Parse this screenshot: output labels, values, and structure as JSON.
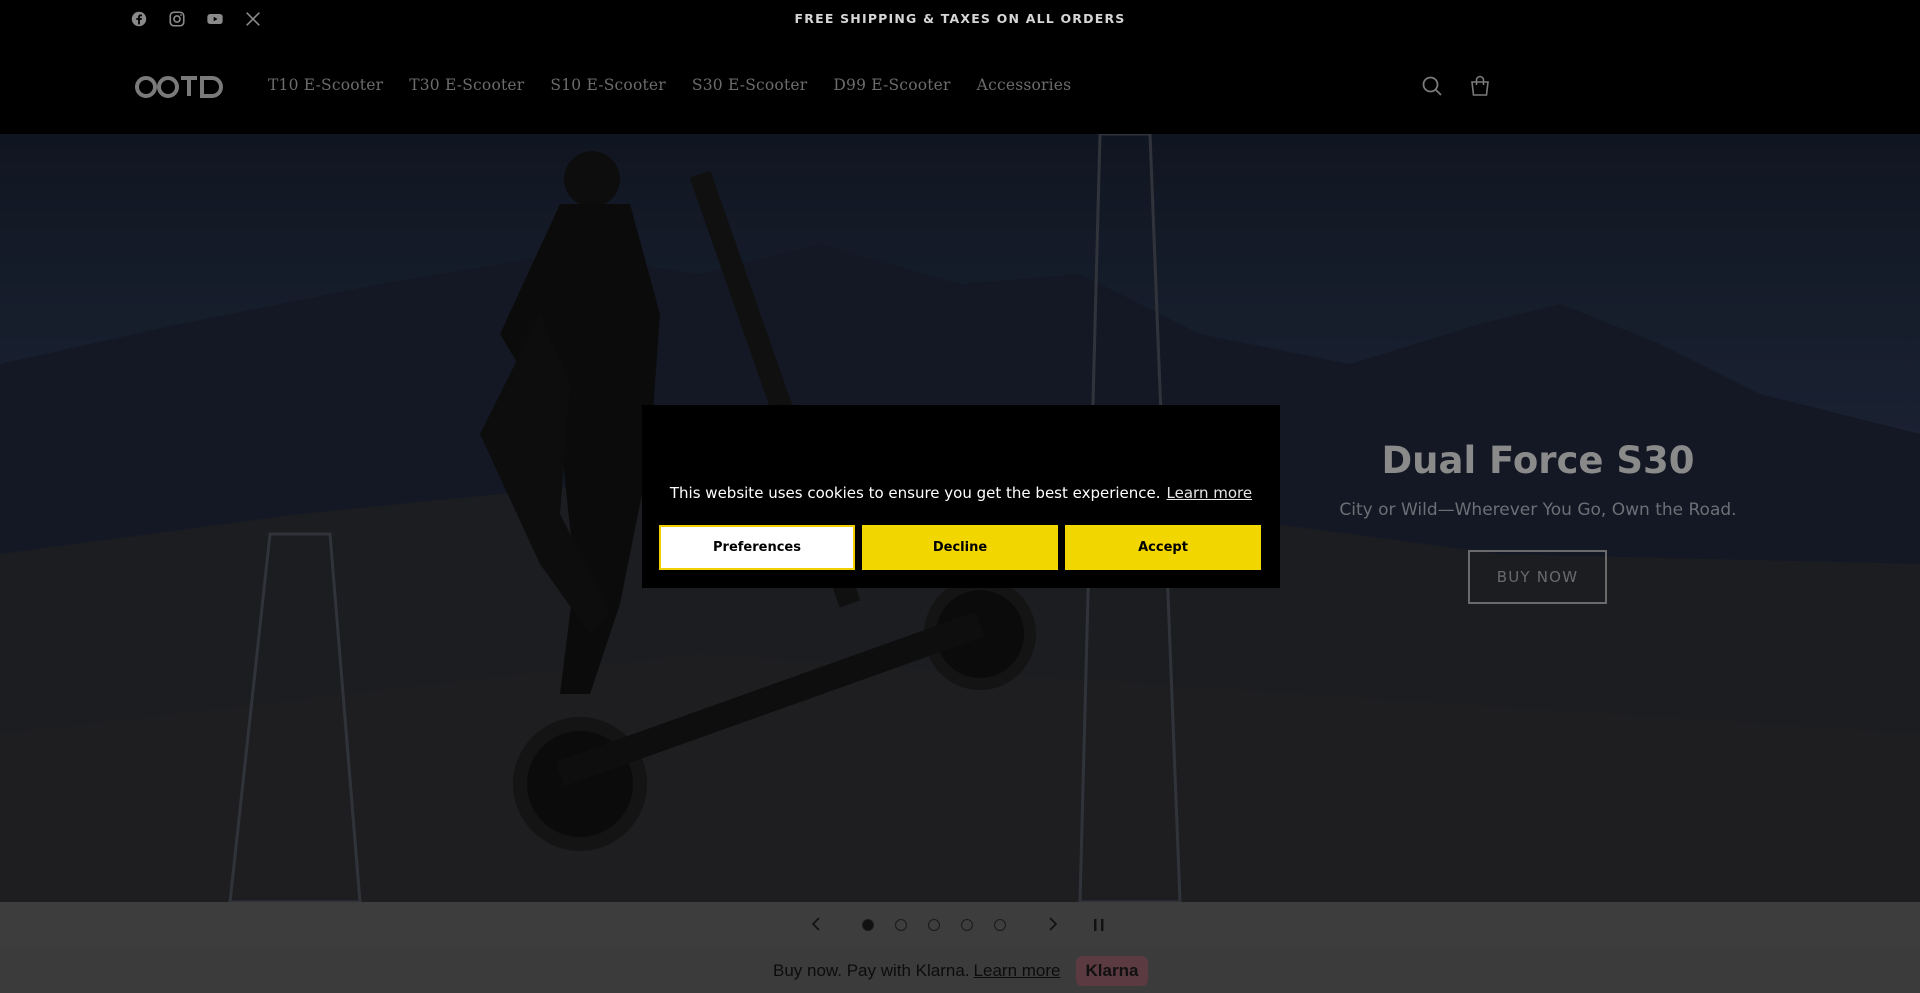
{
  "announcement": {
    "text": "FREE SHIPPING & TAXES ON ALL ORDERS"
  },
  "social": [
    "facebook-icon",
    "instagram-icon",
    "youtube-icon",
    "x-icon"
  ],
  "nav": {
    "items": [
      {
        "label": "T10 E-Scooter"
      },
      {
        "label": "T30 E-Scooter"
      },
      {
        "label": "S10 E-Scooter"
      },
      {
        "label": "S30 E-Scooter"
      },
      {
        "label": "D99 E-Scooter"
      },
      {
        "label": "Accessories"
      }
    ]
  },
  "hero": {
    "title": "Dual Force S30",
    "subtitle": "City or Wild—Wherever You Go, Own the Road.",
    "cta": "BUY NOW"
  },
  "slider": {
    "slide_count": 5,
    "active_index": 0
  },
  "klarna": {
    "text": "Buy now. Pay with Klarna.",
    "link": "Learn more",
    "badge": "Klarna"
  },
  "cookie": {
    "message": "This website uses cookies to ensure you get the best experience.",
    "learn_more": "Learn more",
    "preferences": "Preferences",
    "decline": "Decline",
    "accept": "Accept"
  },
  "colors": {
    "accent_yellow": "#f2d600",
    "background": "#000000"
  }
}
